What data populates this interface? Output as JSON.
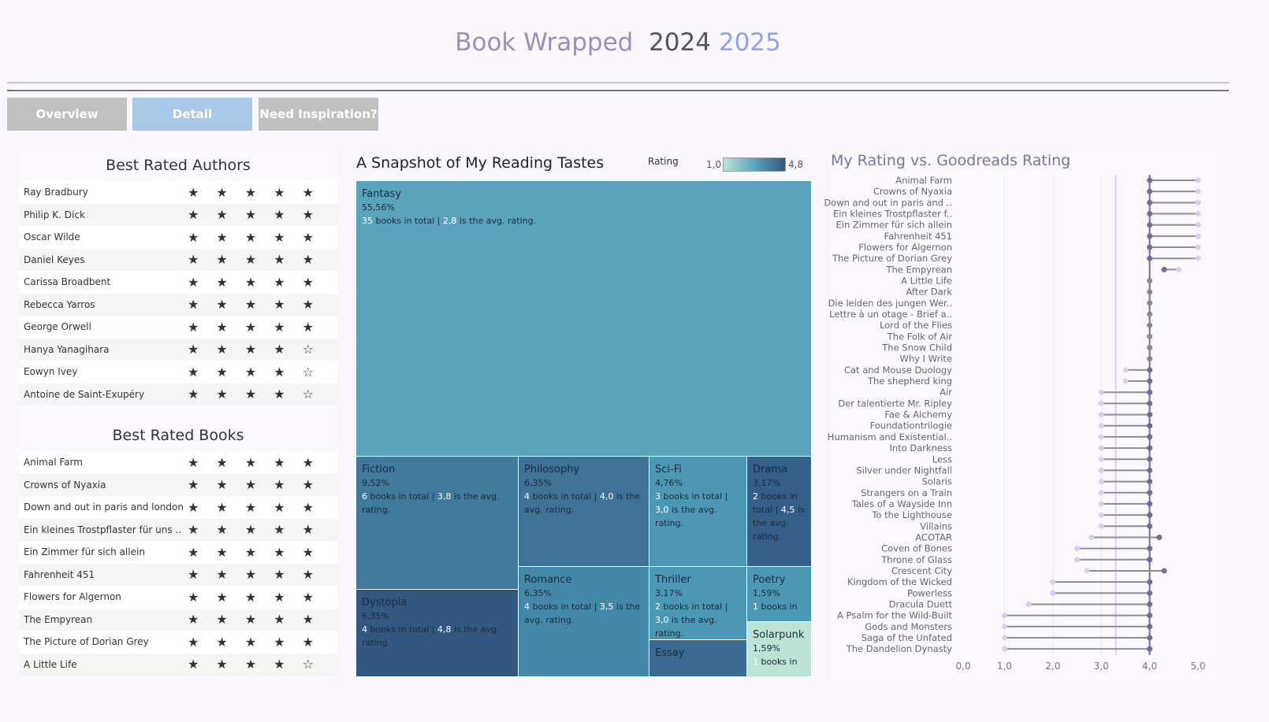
{
  "header": {
    "title": "Book Wrapped",
    "year_a": "2024",
    "year_b": "2025"
  },
  "nav": {
    "overview": "Overview",
    "detail": "Detail",
    "inspiration": "Need Inspiration?"
  },
  "authors": {
    "title": "Best Rated Authors",
    "items": [
      {
        "name": "Ray Bradbury",
        "stars": 5
      },
      {
        "name": "Philip K. Dick",
        "stars": 5
      },
      {
        "name": "Oscar Wilde",
        "stars": 5
      },
      {
        "name": "Daniel Keyes",
        "stars": 5
      },
      {
        "name": "Carissa Broadbent",
        "stars": 5
      },
      {
        "name": "Rebecca Yarros",
        "stars": 5
      },
      {
        "name": "George Orwell",
        "stars": 5
      },
      {
        "name": "Hanya Yanagihara",
        "stars": 4
      },
      {
        "name": "Eowyn Ivey",
        "stars": 4
      },
      {
        "name": "Antoine de Saint-Exupéry",
        "stars": 4
      }
    ]
  },
  "books": {
    "title": "Best Rated Books",
    "items": [
      {
        "name": "Animal Farm",
        "stars": 5
      },
      {
        "name": "Crowns of Nyaxia",
        "stars": 5
      },
      {
        "name": "Down and out in paris and london",
        "stars": 5
      },
      {
        "name": "Ein kleines Trostpflaster für uns ..",
        "stars": 5
      },
      {
        "name": "Ein Zimmer für sich allein",
        "stars": 5
      },
      {
        "name": "Fahrenheit 451",
        "stars": 5
      },
      {
        "name": "Flowers for Algernon",
        "stars": 5
      },
      {
        "name": "The Empyrean",
        "stars": 5
      },
      {
        "name": "The Picture of Dorian Grey",
        "stars": 5
      },
      {
        "name": "A Little Life",
        "stars": 4
      }
    ]
  },
  "treemap": {
    "title": "A Snapshot of My Reading Tastes",
    "legend_label": "Rating",
    "legend_min": "1,0",
    "legend_max": "4,8",
    "tiles": [
      {
        "genre": "Fantasy",
        "pct": "55,56%",
        "books": "35",
        "avg": "2,8",
        "t1": " books in total | ",
        "t2": " is the avg. rating.",
        "color": "#5aa4bb"
      },
      {
        "genre": "Fiction",
        "pct": "9,52%",
        "books": "6",
        "avg": "3,8",
        "t1": " books in total | ",
        "t2": " is the avg. rating.",
        "color": "#3f7a9c"
      },
      {
        "genre": "Dystopia",
        "pct": "6,35%",
        "books": "4",
        "avg": "4,8",
        "t1": " books in total | ",
        "t2": " is the avg. rating.",
        "color": "#325781"
      },
      {
        "genre": "Philosophy",
        "pct": "6,35%",
        "books": "4",
        "avg": "4,0",
        "t1": " books in total | ",
        "t2": " is the avg. rating.",
        "color": "#3e7397"
      },
      {
        "genre": "Romance",
        "pct": "6,35%",
        "books": "4",
        "avg": "3,5",
        "t1": " books in total | ",
        "t2": " is the avg. rating.",
        "color": "#4388a8"
      },
      {
        "genre": "Sci-Fi",
        "pct": "4,76%",
        "books": "3",
        "avg": "3,0",
        "t1": " books in total | ",
        "t2": " is the avg. rating.",
        "color": "#4c98b4"
      },
      {
        "genre": "Thriller",
        "pct": "3,17%",
        "books": "2",
        "avg": "3,0",
        "t1": " books in total | ",
        "t2": " is the avg. rating.",
        "color": "#4c98b4"
      },
      {
        "genre": "Essay",
        "pct": "",
        "books": "",
        "avg": "",
        "t1": "",
        "t2": "",
        "color": "#3a6a91"
      },
      {
        "genre": "Drama",
        "pct": "3,17%",
        "books": "2",
        "avg": "4,5",
        "t1": " books in total | ",
        "t2": " is the avg. rating.",
        "color": "#345f89"
      },
      {
        "genre": "Poetry",
        "pct": "1,59%",
        "books": "1",
        "avg": "",
        "t1": " books in",
        "t2": "",
        "color": "#4c98b4"
      },
      {
        "genre": "Solarpunk",
        "pct": "1,59%",
        "books": "1",
        "avg": "",
        "t1": " books in",
        "t2": "",
        "color": "#bde3d6"
      }
    ]
  },
  "chart_data": {
    "type": "lollipop",
    "title": "My Rating vs. Goodreads Rating",
    "xlim": [
      0,
      5
    ],
    "xticks": [
      "0,0",
      "1,0",
      "2,0",
      "3,0",
      "4,0",
      "5,0"
    ],
    "avg_my_rating": 3.3,
    "avg_goodreads": 4.0,
    "series": [
      "my_rating",
      "goodreads_rating"
    ],
    "books": [
      [
        "Animal Farm",
        5,
        4
      ],
      [
        "Crowns of Nyaxia",
        5,
        4
      ],
      [
        "Down and out in paris and ..",
        5,
        4
      ],
      [
        "Ein kleines Trostpflaster f..",
        5,
        4
      ],
      [
        "Ein Zimmer für sich allein",
        5,
        4
      ],
      [
        "Fahrenheit 451",
        5,
        4
      ],
      [
        "Flowers for Algernon",
        5,
        4
      ],
      [
        "The Picture of Dorian Grey",
        5,
        4
      ],
      [
        "The Empyrean",
        4.6,
        4.3
      ],
      [
        "A Little Life",
        4,
        4
      ],
      [
        "After Dark",
        4,
        4
      ],
      [
        "Die leiden des jungen Wer..",
        4,
        4
      ],
      [
        "Lettre à un otage - Brief a..",
        4,
        4
      ],
      [
        "Lord of the Flies",
        4,
        4
      ],
      [
        "The Folk of Air",
        4,
        4
      ],
      [
        "The Snow Child",
        4,
        4
      ],
      [
        "Why I Write",
        4,
        4
      ],
      [
        "Cat and Mouse Duology",
        3.5,
        4
      ],
      [
        "The shepherd king",
        3.5,
        4
      ],
      [
        "Air",
        3,
        4
      ],
      [
        "Der talentierte Mr. Ripley",
        3,
        4
      ],
      [
        "Fae & Alchemy",
        3,
        4
      ],
      [
        "Foundationtrilogie",
        3,
        4
      ],
      [
        "Humanism and Existential..",
        3,
        4
      ],
      [
        "Into Darkness",
        3,
        4
      ],
      [
        "Less",
        3,
        4
      ],
      [
        "Silver under Nightfall",
        3,
        4
      ],
      [
        "Solaris",
        3,
        4
      ],
      [
        "Strangers on a Train",
        3,
        4
      ],
      [
        "Tales of a Wayside Inn",
        3,
        4
      ],
      [
        "To the Lighthouse",
        3,
        4
      ],
      [
        "Villains",
        3,
        4
      ],
      [
        "ACOTAR",
        2.8,
        4.2
      ],
      [
        "Coven of Bones",
        2.5,
        4
      ],
      [
        "Throne of Glass",
        2.5,
        4
      ],
      [
        "Crescent City",
        2.7,
        4.3
      ],
      [
        "Kingdom of the Wicked",
        2,
        4
      ],
      [
        "Powerless",
        2,
        4
      ],
      [
        "Dracula Duett",
        1.5,
        4
      ],
      [
        "A Psalm for the Wild-Built",
        1,
        4
      ],
      [
        "Gods and Monsters",
        1,
        4
      ],
      [
        "Saga of the Unfated",
        1,
        4
      ],
      [
        "The Dandelion Dynasty",
        1,
        4
      ]
    ]
  },
  "colors": {
    "my": "#e2c9f5",
    "goodreads": "#75689a",
    "equal": "#8a8a8e",
    "line": "#8d8d91"
  }
}
